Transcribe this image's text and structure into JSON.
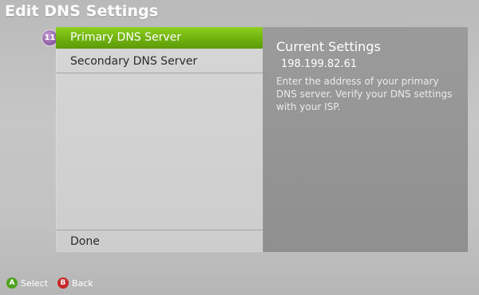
{
  "header": {
    "title": "Edit DNS Settings"
  },
  "menu": {
    "badge": "11",
    "items": [
      {
        "label": "Primary DNS Server",
        "selected": true
      },
      {
        "label": "Secondary DNS Server",
        "selected": false
      }
    ],
    "done_label": "Done"
  },
  "info": {
    "title": "Current Settings",
    "ip": "198.199.82.61",
    "description": "Enter the address of your primary DNS server. Verify your DNS settings with your ISP."
  },
  "footer": {
    "a_button": "A",
    "a_label": "Select",
    "b_button": "B",
    "b_label": "Back"
  },
  "colors": {
    "highlight": "#6fb10d",
    "a_button": "#4fa21e",
    "b_button": "#c6282a",
    "badge": "#8b5aa2"
  }
}
